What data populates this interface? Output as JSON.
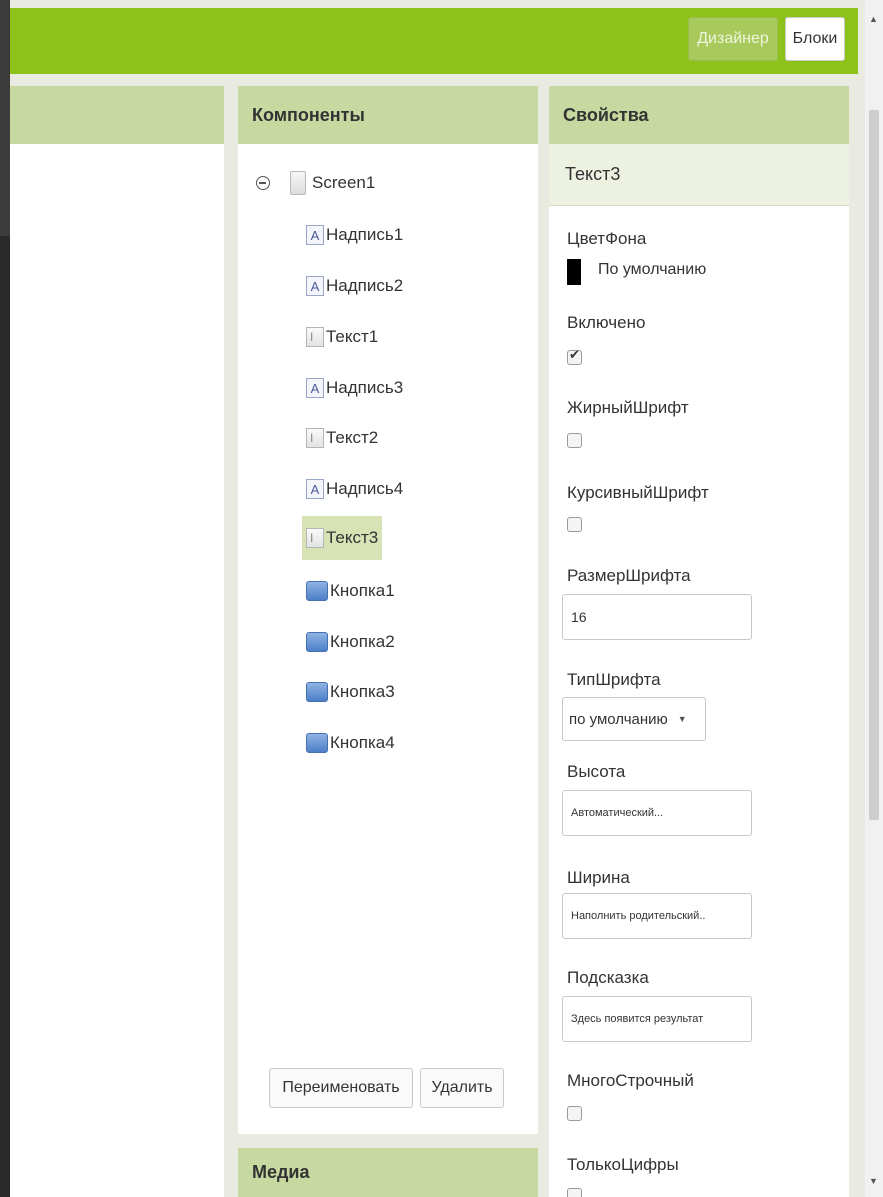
{
  "toolbar": {
    "designer_label": "Дизайнер",
    "blocks_label": "Блоки"
  },
  "components": {
    "title": "Компоненты",
    "root": "Screen1",
    "items": [
      {
        "label": "Надпись1",
        "icon": "label-icon"
      },
      {
        "label": "Надпись2",
        "icon": "label-icon"
      },
      {
        "label": "Текст1",
        "icon": "textbox-icon"
      },
      {
        "label": "Надпись3",
        "icon": "label-icon"
      },
      {
        "label": "Текст2",
        "icon": "textbox-icon"
      },
      {
        "label": "Надпись4",
        "icon": "label-icon"
      },
      {
        "label": "Текст3",
        "icon": "textbox-icon",
        "selected": true
      },
      {
        "label": "Кнопка1",
        "icon": "button-icon"
      },
      {
        "label": "Кнопка2",
        "icon": "button-icon"
      },
      {
        "label": "Кнопка3",
        "icon": "button-icon"
      },
      {
        "label": "Кнопка4",
        "icon": "button-icon"
      }
    ],
    "rename_label": "Переименовать",
    "delete_label": "Удалить"
  },
  "media": {
    "title": "Медиа"
  },
  "properties": {
    "title": "Свойства",
    "selected_component": "Текст3",
    "background_color": {
      "label": "ЦветФона",
      "value": "По умолчанию",
      "swatch": "#000000"
    },
    "enabled": {
      "label": "Включено",
      "checked": true
    },
    "bold": {
      "label": "ЖирныйШрифт",
      "checked": false
    },
    "italic": {
      "label": "КурсивныйШрифт",
      "checked": false
    },
    "font_size": {
      "label": "РазмерШрифта",
      "value": "16"
    },
    "font_type": {
      "label": "ТипШрифта",
      "value": "по умолчанию"
    },
    "height": {
      "label": "Высота",
      "value": "Автоматический..."
    },
    "width": {
      "label": "Ширина",
      "value": "Наполнить родительский.."
    },
    "hint": {
      "label": "Подсказка",
      "value": "Здесь появится результат"
    },
    "multiline": {
      "label": "МногоСтрочный",
      "checked": false
    },
    "numbers_only": {
      "label": "ТолькоЦифры",
      "checked": false
    }
  },
  "colors": {
    "toolbar": "#8cc219",
    "panel_header": "#c7d9a0",
    "selected_item": "#d7e3b4"
  }
}
